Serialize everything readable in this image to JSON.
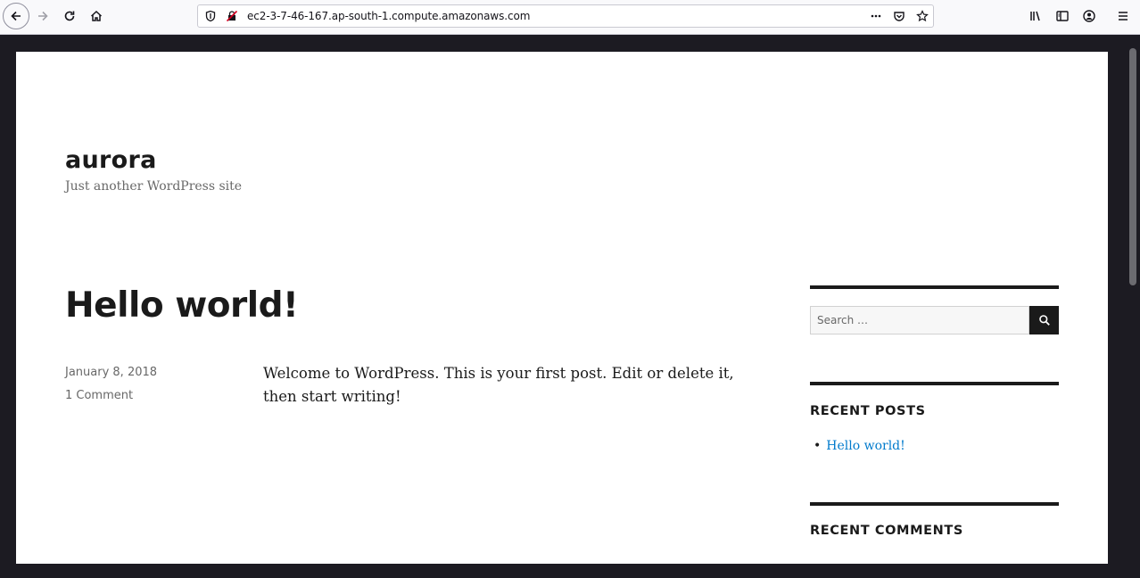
{
  "browser": {
    "url": "ec2-3-7-46-167.ap-south-1.compute.amazonaws.com",
    "icons": {
      "back": "back-icon",
      "forward": "forward-icon",
      "reload": "reload-icon",
      "home": "home-icon",
      "shield": "shield-icon",
      "insecure": "insecure-lock-icon",
      "more": "more-icon",
      "pocket": "pocket-icon",
      "bookmark": "bookmark-star-icon",
      "library": "library-icon",
      "sidebar": "sidebar-icon",
      "account": "account-icon",
      "menu": "menu-icon"
    }
  },
  "site": {
    "title": "aurora",
    "description": "Just another WordPress site"
  },
  "post": {
    "title": "Hello world!",
    "date": "January 8, 2018",
    "comments": "1 Comment",
    "content": "Welcome to WordPress. This is your first post. Edit or delete it, then start writing!"
  },
  "sidebar": {
    "search_placeholder": "Search …",
    "recent_posts_title": "RECENT POSTS",
    "recent_posts": [
      "Hello world!"
    ],
    "recent_comments_title": "RECENT COMMENTS"
  },
  "colors": {
    "link": "#007acc",
    "text": "#1a1a1a",
    "meta": "#686868",
    "frame": "#1c1b22"
  }
}
